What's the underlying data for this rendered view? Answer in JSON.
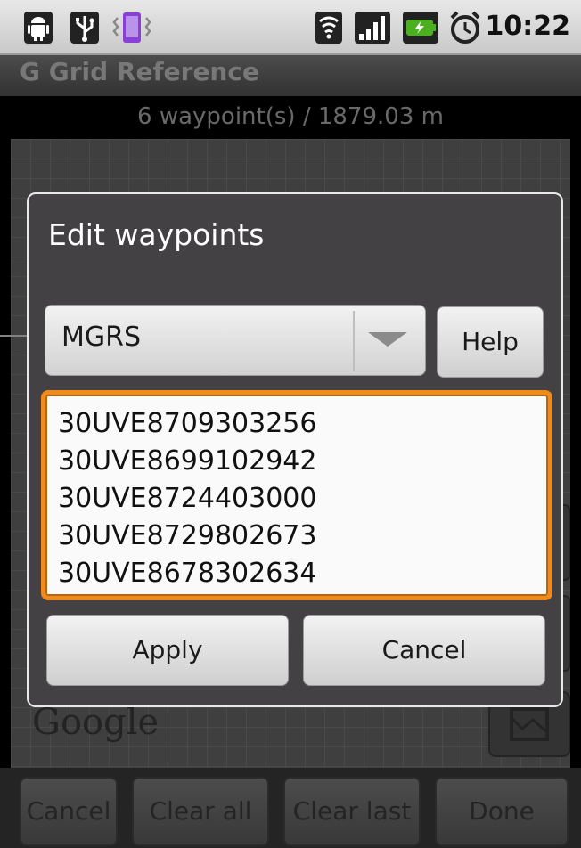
{
  "status_bar": {
    "time": "10:22",
    "left_icons": [
      "android-debug-icon",
      "usb-icon",
      "vibrate-icon"
    ],
    "right_icons": [
      "wifi-icon",
      "signal-icon",
      "battery-charging-icon",
      "alarm-icon"
    ]
  },
  "app": {
    "title": "G Grid Reference",
    "summary": "6 waypoint(s) / 1879.03 m"
  },
  "map": {
    "attribution": "Google"
  },
  "dialog": {
    "title": "Edit waypoints",
    "format_select": {
      "value": "MGRS"
    },
    "help_label": "Help",
    "waypoints": [
      "30UVE8709303256",
      "30UVE8699102942",
      "30UVE8724403000",
      "30UVE8729802673",
      "30UVE8678302634"
    ],
    "apply_label": "Apply",
    "cancel_label": "Cancel"
  },
  "bottom_bar": {
    "cancel_label": "Cancel",
    "clear_all_label": "Clear all",
    "clear_last_label": "Clear last",
    "done_label": "Done"
  },
  "colors": {
    "accent_focus": "#ef8a1b",
    "dialog_bg": "#434144"
  }
}
